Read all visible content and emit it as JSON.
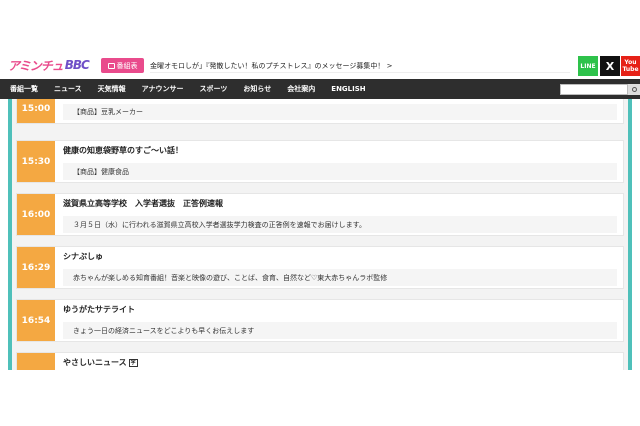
{
  "header": {
    "logo_part1": "アミンチュ",
    "logo_part2": "BBC",
    "program_button_label": "番組表",
    "ticker_text": "金曜オモロしが」『発散したい！私のプチストレス』のメッセージ募集中！ >",
    "social": {
      "line": "LINE",
      "x": "X",
      "youtube_1": "You",
      "youtube_2": "Tube"
    }
  },
  "nav": {
    "items": [
      "番組一覧",
      "ニュース",
      "天気情報",
      "アナウンサー",
      "スポーツ",
      "お知らせ",
      "会社案内",
      "ENGLISH"
    ],
    "search_placeholder": ""
  },
  "schedule": [
    {
      "time": "15:00",
      "title": "",
      "description": "【商品】豆乳メーカー"
    },
    {
      "time": "15:30",
      "title": "健康の知恵袋野草のすご～い話！",
      "description": "【商品】健康食品"
    },
    {
      "time": "16:00",
      "title": "滋賀県立高等学校　入学者選抜　正答例速報",
      "description": "３月５日（水）に行われる滋賀県立高校入学者選抜学力検査の正答例を速報でお届けします。"
    },
    {
      "time": "16:29",
      "title": "シナぷしゅ",
      "description": "赤ちゃんが楽しめる知育番組！音楽と映像の遊び、ことば、食育、自然など♡東大赤ちゃんラボ監修"
    },
    {
      "time": "16:54",
      "title": "ゆうがたサテライト",
      "description": "きょう一日の経済ニュースをどこよりも早くお伝えします"
    },
    {
      "time": "",
      "title": "やさしいニュース",
      "badge": "字",
      "description": ""
    }
  ],
  "colors": {
    "accent_pink": "#e94b8c",
    "time_orange": "#f4a842",
    "frame_teal": "#4fc0ba",
    "nav_dark": "#2e2e2e"
  }
}
